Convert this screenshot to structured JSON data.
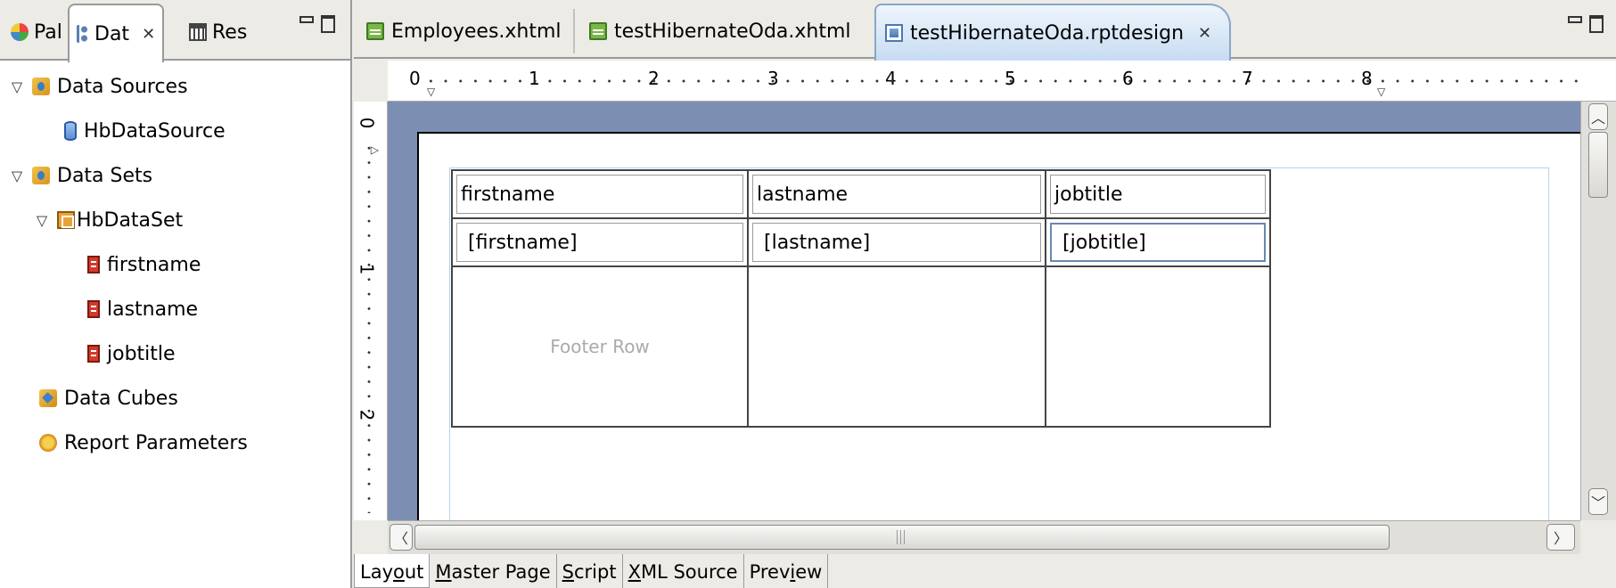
{
  "left_view": {
    "tabs": [
      {
        "label": "Pal",
        "icon": "palette-icon"
      },
      {
        "label": "Dat",
        "icon": "data-explorer-icon",
        "close": "✕"
      },
      {
        "label": "Res",
        "icon": "resource-explorer-icon"
      }
    ],
    "tree": [
      {
        "label": "Data Sources",
        "icon": "data-sources-folder-icon",
        "expanded": true,
        "level": 0
      },
      {
        "label": "HbDataSource",
        "icon": "database-icon",
        "level": 1
      },
      {
        "label": "Data Sets",
        "icon": "data-sets-folder-icon",
        "expanded": true,
        "level": 0
      },
      {
        "label": "HbDataSet",
        "icon": "dataset-icon",
        "expanded": true,
        "level": 1
      },
      {
        "label": "firstname",
        "icon": "column-icon",
        "level": 2
      },
      {
        "label": "lastname",
        "icon": "column-icon",
        "level": 2
      },
      {
        "label": "jobtitle",
        "icon": "column-icon",
        "level": 2
      },
      {
        "label": "Data Cubes",
        "icon": "data-cubes-icon",
        "level": 0
      },
      {
        "label": "Report Parameters",
        "icon": "report-parameters-icon",
        "level": 0
      }
    ]
  },
  "editor": {
    "tabs": [
      {
        "label": "Employees.xhtml",
        "icon": "xhtml-file-icon"
      },
      {
        "label": "testHibernateOda.xhtml",
        "icon": "xhtml-file-icon"
      },
      {
        "label": "testHibernateOda.rptdesign",
        "icon": "report-design-icon",
        "active": true,
        "close": "✕"
      }
    ],
    "ruler_h_numbers": [
      "0",
      "1",
      "2",
      "3",
      "4",
      "5",
      "6",
      "7",
      "8"
    ],
    "ruler_v_numbers": [
      "0",
      "1",
      "2"
    ],
    "table": {
      "headers": [
        "firstname",
        "lastname",
        "jobtitle"
      ],
      "details": [
        "[firstname]",
        "[lastname]",
        "[jobtitle]"
      ],
      "footer_label": "Footer Row"
    },
    "bottom_tabs": [
      {
        "label": "Layout",
        "mnemonic_index": 3,
        "active": true
      },
      {
        "label": "Master Page",
        "mnemonic_index": 0
      },
      {
        "label": "Script",
        "mnemonic_index": 0
      },
      {
        "label": "XML Source",
        "mnemonic_index": 0
      },
      {
        "label": "Preview",
        "mnemonic_index": 4
      }
    ]
  }
}
